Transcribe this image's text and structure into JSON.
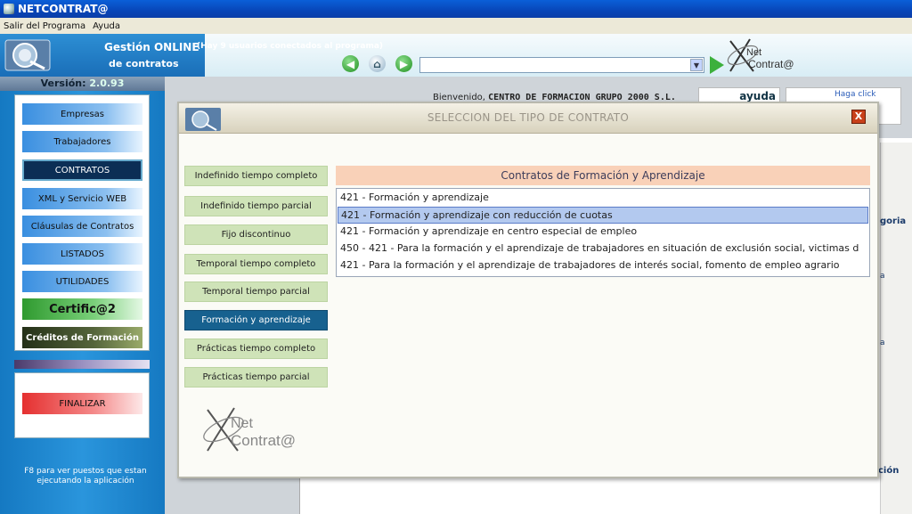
{
  "window": {
    "title": "NETCONTRAT@"
  },
  "menubar": {
    "items": [
      "Salir del Programa",
      "Ayuda"
    ]
  },
  "header": {
    "title": "Gestión ONLINE",
    "users_status": "(Hay 9 usuarios conectados al programa)",
    "subtitle": "de contratos",
    "back_icon": "arrow-left-icon",
    "home_icon": "home-icon",
    "forward_icon": "arrow-right-icon",
    "address_value": "",
    "logo_net": "Net",
    "logo_contrata": "Contrat@"
  },
  "sidebar": {
    "version_label": "Versión:",
    "version_value": "2.0.93",
    "items": [
      {
        "label": "Empresas"
      },
      {
        "label": "Trabajadores"
      },
      {
        "label": "CONTRATOS"
      },
      {
        "label": "XML y Servicio WEB"
      },
      {
        "label": "Cláusulas de Contratos"
      },
      {
        "label": "LISTADOS"
      },
      {
        "label": "UTILIDADES"
      },
      {
        "label": "Certific@2"
      },
      {
        "label": "Créditos de Formación"
      }
    ],
    "finalizar": "FINALIZAR",
    "hint": "F8 para ver puestos que estan ejecutando la aplicación"
  },
  "background": {
    "welcome_prefix": "Bienvenido,",
    "welcome_company": "CENTRO DE FORMACION GRUPO 2000 S.L.",
    "ayuda": "ayuda",
    "haga_click": "Haga click",
    "frag_categoria": "goria",
    "frag_a1": "a",
    "frag_a2": "a",
    "frag_cion": "ción"
  },
  "dialog": {
    "title": "SELECCION DEL TIPO DE CONTRATO",
    "close_label": "X",
    "contract_types": [
      {
        "label": "Indefinido tiempo completo"
      },
      {
        "label": "Indefinido tiempo parcial"
      },
      {
        "label": "Fijo discontinuo"
      },
      {
        "label": "Temporal tiempo completo"
      },
      {
        "label": "Temporal tiempo parcial"
      },
      {
        "label": "Formación y aprendizaje"
      },
      {
        "label": "Prácticas tiempo completo"
      },
      {
        "label": "Prácticas tiempo parcial"
      }
    ],
    "active_type_index": 5,
    "list_header": "Contratos de Formación y Aprendizaje",
    "contracts": [
      {
        "label": "421 - Formación y aprendizaje"
      },
      {
        "label": "421 - Formación y aprendizaje con reducción de cuotas"
      },
      {
        "label": "421 - Formación y aprendizaje en centro especial de empleo"
      },
      {
        "label": "450 - 421 - Para la formación y el aprendizaje de trabajadores en situación de exclusión social, victimas d"
      },
      {
        "label": "421 - Para la formación y el aprendizaje de trabajadores de interés social, fomento de empleo agrario"
      }
    ],
    "selected_contract_index": 1,
    "logo_net": "Net",
    "logo_contrata": "Contrat@"
  },
  "colors": {
    "titlebar": "#0a5fd8",
    "active_type": "#17618f",
    "type_button": "#cfe3b8",
    "list_header": "#f9d1b8",
    "selected_row": "#b3c9ef"
  }
}
